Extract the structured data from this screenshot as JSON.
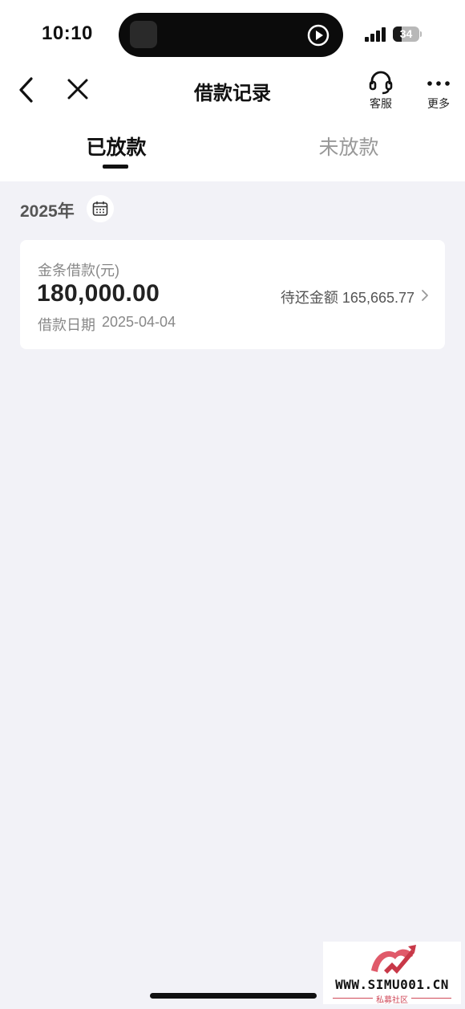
{
  "status_bar": {
    "time": "10:10",
    "battery_level": "34",
    "battery_percent": 34
  },
  "nav": {
    "title": "借款记录",
    "service_label": "客服",
    "more_label": "更多"
  },
  "tabs": [
    {
      "label": "已放款",
      "active": true
    },
    {
      "label": "未放款",
      "active": false
    }
  ],
  "year": "2025年",
  "loan_card": {
    "product_label": "金条借款(元)",
    "amount": "180,000.00",
    "date_label": "借款日期",
    "date_value": "2025-04-04",
    "remaining_label": "待还金额 165,665.77"
  },
  "watermark": {
    "text": "WWW.SIMU001.CN",
    "sub": "私募社区"
  },
  "colors": {
    "page_background": "#f2f2f7",
    "card_background": "#ffffff",
    "primary_text": "#111111",
    "secondary_text": "#888888",
    "watermark_accent": "#d04a5a"
  }
}
